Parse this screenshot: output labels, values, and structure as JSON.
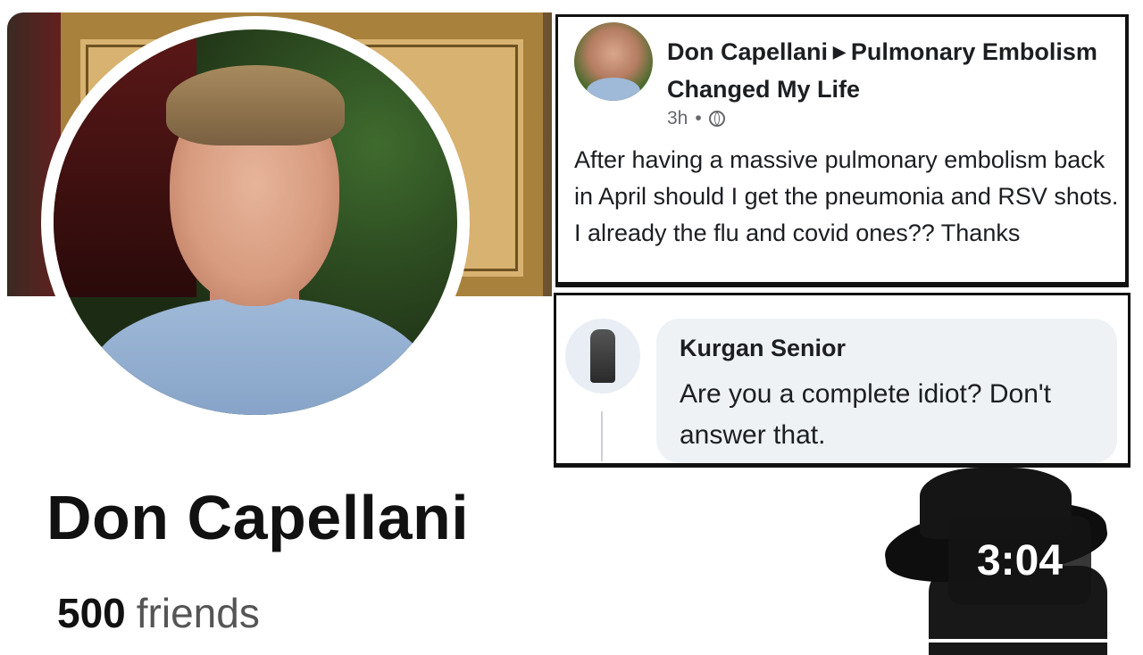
{
  "profile": {
    "name": "Don Capellani",
    "friends_count": "500",
    "friends_label": "friends"
  },
  "post": {
    "author": "Don Capellani",
    "group": "Pulmonary Embolism Changed My Life",
    "time": "3h",
    "separator": "•",
    "body": "After having a massive pulmonary embolism back in April should I get the pneumonia and RSV shots. I already the flu and covid ones?? Thanks"
  },
  "comment": {
    "author": "Kurgan Senior",
    "text": "Are you a complete idiot? Don't answer that."
  },
  "video": {
    "duration": "3:04"
  }
}
